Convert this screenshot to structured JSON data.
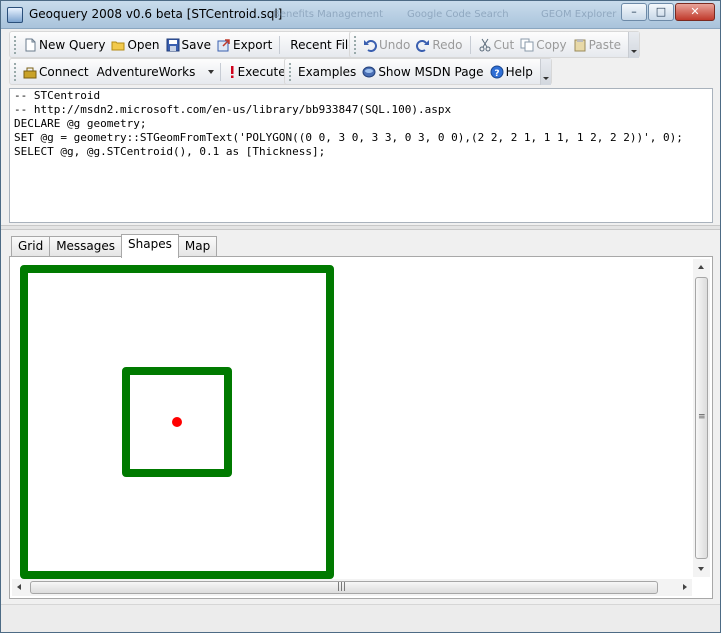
{
  "window": {
    "title": "Geoquery 2008 v0.6 beta [STCentroid.sql]",
    "background_titles": [
      "Benefits Management",
      "Google Code Search",
      "GEOM Explorer"
    ],
    "minimize_glyph": "–",
    "maximize_glyph": "□",
    "close_glyph": "✕"
  },
  "toolbar1": {
    "new_query": "New Query",
    "open": "Open",
    "save": "Save",
    "export": "Export",
    "recent_files": "Recent Files",
    "undo": "Undo",
    "redo": "Redo",
    "cut": "Cut",
    "copy": "Copy",
    "paste": "Paste"
  },
  "toolbar2": {
    "connect": "Connect",
    "database": "AdventureWorks",
    "execute": "Execute",
    "examples": "Examples",
    "show_msdn": "Show MSDN Page",
    "help": "Help"
  },
  "editor": {
    "lines": [
      "-- STCentroid",
      "-- http://msdn2.microsoft.com/en-us/library/bb933847(SQL.100).aspx",
      "DECLARE @g geometry;",
      "SET @g = geometry::STGeomFromText('POLYGON((0 0, 3 0, 3 3, 0 3, 0 0),(2 2, 2 1, 1 1, 1 2, 2 2))', 0);",
      "SELECT @g, @g.STCentroid(), 0.1 as [Thickness];"
    ]
  },
  "tabs": [
    {
      "label": "Grid",
      "active": false
    },
    {
      "label": "Messages",
      "active": false
    },
    {
      "label": "Shapes",
      "active": true
    },
    {
      "label": "Map",
      "active": false
    }
  ],
  "shapes": {
    "outer_ring": [
      [
        0,
        0
      ],
      [
        3,
        0
      ],
      [
        3,
        3
      ],
      [
        0,
        3
      ],
      [
        0,
        0
      ]
    ],
    "inner_ring": [
      [
        2,
        2
      ],
      [
        2,
        1
      ],
      [
        1,
        1
      ],
      [
        1,
        2
      ],
      [
        2,
        2
      ]
    ],
    "centroid": [
      1.5,
      1.5
    ],
    "thickness": 0.1,
    "polygon_color": "#007a00",
    "centroid_color": "#ff0000"
  },
  "scroll": {
    "h_grip": "|||",
    "v_grip": "≡"
  },
  "icons": {
    "new_query": "document-icon",
    "open": "folder-icon",
    "save": "save-icon",
    "export": "export-icon",
    "undo": "undo-icon",
    "redo": "redo-icon",
    "cut": "scissors-icon",
    "copy": "copy-icon",
    "paste": "paste-icon",
    "connect": "connect-icon",
    "execute": "execute-icon",
    "msdn": "msdn-icon",
    "help": "help-icon"
  }
}
